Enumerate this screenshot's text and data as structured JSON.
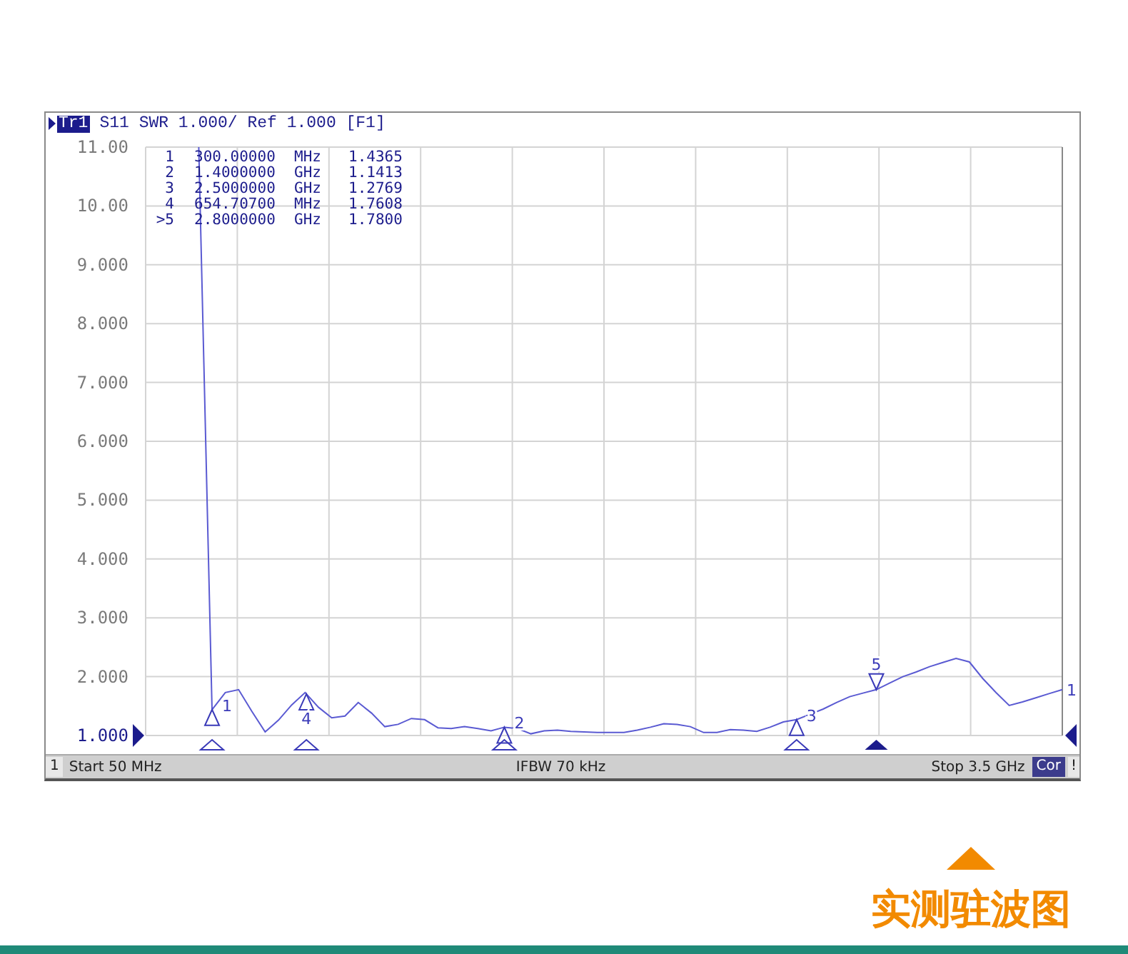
{
  "window": {
    "trace_tag": "Tr1",
    "title": "S11 SWR 1.000/ Ref 1.000 [F1]",
    "marker_table": [
      {
        "label": "1",
        "frequency": "300.00000",
        "unit": "MHz",
        "value": "1.4365"
      },
      {
        "label": "2",
        "frequency": "1.4000000",
        "unit": "GHz",
        "value": "1.1413"
      },
      {
        "label": "3",
        "frequency": "2.5000000",
        "unit": "GHz",
        "value": "1.2769"
      },
      {
        "label": "4",
        "frequency": "654.70700",
        "unit": "MHz",
        "value": "1.7608"
      },
      {
        "label": ">5",
        "frequency": "2.8000000",
        "unit": "GHz",
        "value": "1.7800"
      }
    ],
    "chart_data": {
      "type": "line",
      "categories": [
        null,
        null,
        null,
        null,
        null,
        null,
        null,
        null,
        null,
        null,
        null,
        null,
        null,
        null,
        null,
        null,
        null,
        null,
        null,
        null,
        null,
        null,
        null,
        null,
        null,
        null,
        null,
        null,
        null,
        null,
        null,
        null,
        null,
        null,
        null,
        null,
        null,
        null,
        null,
        null,
        null,
        null,
        null,
        null,
        null,
        null,
        null,
        null,
        null,
        null,
        null,
        null,
        null,
        null,
        null,
        null,
        null,
        null,
        null,
        null,
        null,
        null,
        null,
        null,
        null,
        null,
        null,
        null,
        null,
        null
      ],
      "series": [
        {
          "color": "#5a5ad2",
          "values": [
            null,
            null,
            null,
            null,
            11,
            1.44,
            1.73,
            1.78,
            1.41,
            1.06,
            1.26,
            1.52,
            1.73,
            1.48,
            1.3,
            1.33,
            1.56,
            1.38,
            1.15,
            1.19,
            1.29,
            1.27,
            1.13,
            1.12,
            1.15,
            1.12,
            1.08,
            1.14,
            1.12,
            1.03,
            1.08,
            1.09,
            1.07,
            1.06,
            1.05,
            1.05,
            1.05,
            1.09,
            1.14,
            1.2,
            1.19,
            1.15,
            1.05,
            1.05,
            1.1,
            1.09,
            1.07,
            1.14,
            1.23,
            1.27,
            1.36,
            1.45,
            1.56,
            1.66,
            1.72,
            1.78,
            1.89,
            2.0,
            2.08,
            2.17,
            2.24,
            2.31,
            2.25,
            1.97,
            1.73,
            1.51,
            1.57,
            1.64,
            1.71,
            1.78
          ]
        }
      ],
      "ylim": [
        1,
        11
      ],
      "yticks": [
        {
          "value": 11,
          "label": "11.00"
        },
        {
          "value": 10,
          "label": "10.00"
        },
        {
          "value": 9,
          "label": "9.000"
        },
        {
          "value": 8,
          "label": "8.000"
        },
        {
          "value": 7,
          "label": "7.000"
        },
        {
          "value": 6,
          "label": "6.000"
        },
        {
          "value": 5,
          "label": "5.000"
        },
        {
          "value": 4,
          "label": "4.000"
        },
        {
          "value": 3,
          "label": "3.000"
        },
        {
          "value": 2,
          "label": "2.000"
        },
        {
          "value": 1,
          "label": "1.000"
        }
      ],
      "grid": true
    },
    "plot_markers": [
      {
        "text": "1",
        "active": false
      },
      {
        "text": "4",
        "active": false
      },
      {
        "text": "2",
        "active": false
      },
      {
        "text": "3",
        "active": false
      },
      {
        "text": "5",
        "active": true
      }
    ],
    "trace_end_label": "1",
    "status_bar": {
      "channel": "1",
      "start": "Start 50 MHz",
      "ifbw": "IFBW 70 kHz",
      "stop": "Stop 3.5 GHz",
      "correction": "Cor",
      "alert": "!"
    }
  },
  "caption": "实测驻波图"
}
